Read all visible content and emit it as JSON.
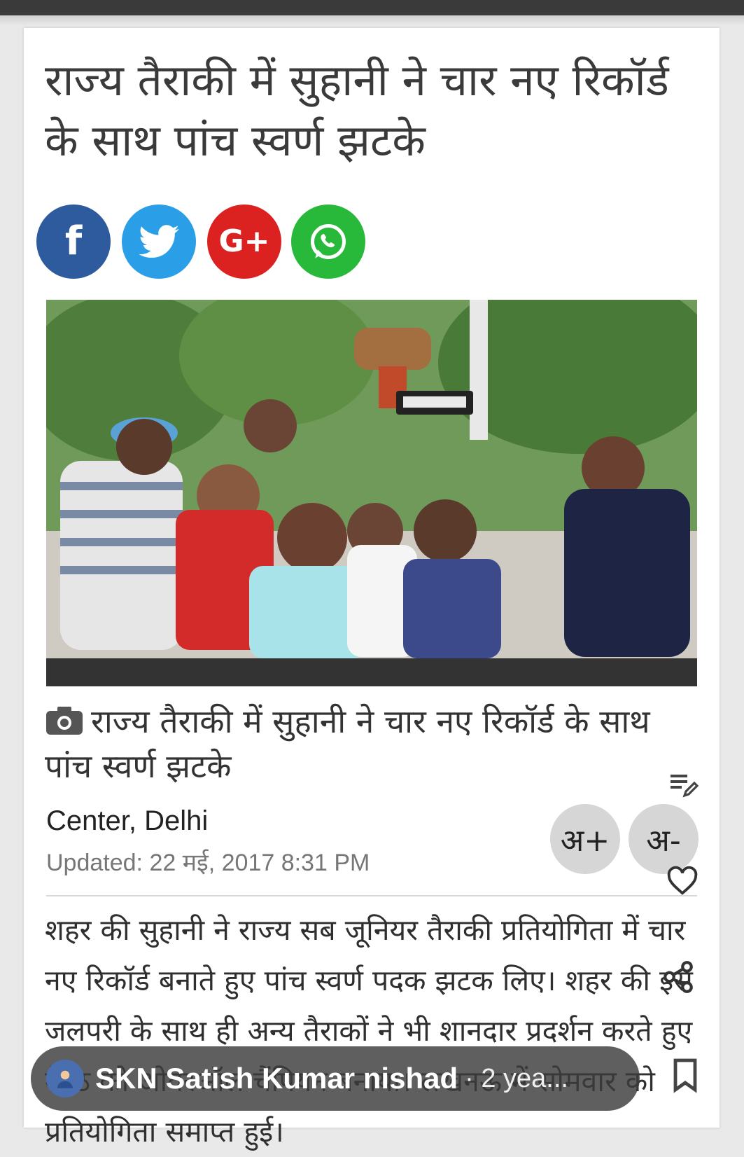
{
  "article": {
    "headline": "राज्य तैराकी में सुहानी ने चार नए रिकॉर्ड के साथ पांच स्वर्ण झटके",
    "caption": "राज्य तैराकी में सुहानी ने चार नए रिकॉर्ड के साथ पांच स्वर्ण झटके",
    "location": "Center, Delhi",
    "updated": "Updated: 22 मई, 2017 8:31 PM",
    "body": "शहर की सुहानी ने राज्य सब जूनियर तैराकी प्रतियोगिता में चार नए रिकॉर्ड बनाते हुए पांच स्वर्ण पदक झटक लिए। शहर की इस जलपरी के साथ ही अन्य तैराकों ने भी शानदार प्रदर्शन करते हुए मेरठ को ओवरऑल चैंपियन बनाया। लखनऊ में सोमवार को प्रतियोगिता समाप्त हुई।"
  },
  "social": {
    "facebook": "f",
    "twitter": "twitter-bird-icon",
    "googleplus": "G+",
    "whatsapp": "whatsapp-icon"
  },
  "font_controls": {
    "increase": "अ+",
    "decrease": "अ-"
  },
  "overlay": {
    "author": "SKN Satish Kumar nishad",
    "meta": "· 2 yea..."
  },
  "colors": {
    "facebook": "#2e5a9e",
    "twitter": "#2a9ee6",
    "googleplus": "#dc2121",
    "whatsapp": "#28b83a"
  }
}
